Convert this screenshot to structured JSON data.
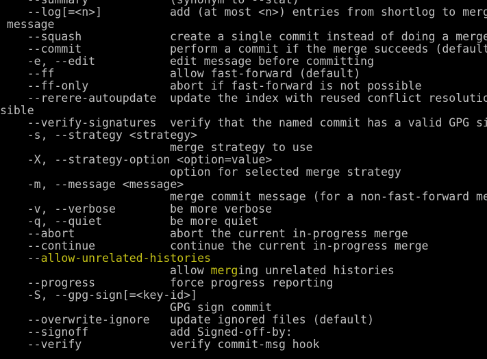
{
  "colors": {
    "background": "#000000",
    "text": "#c0c0c0",
    "highlight": "#c7c418"
  },
  "lines": [
    {
      "opt": "    --summary",
      "desc": "(synonym to --stat)"
    },
    {
      "opt": "    --log[=<n>]",
      "desc": "add (at most <n>) entries from shortlog to merge commit"
    },
    {
      "opt": " message",
      "desc": ""
    },
    {
      "opt": "    --squash",
      "desc": "create a single commit instead of doing a merge"
    },
    {
      "opt": "    --commit",
      "desc": "perform a commit if the merge succeeds (default)"
    },
    {
      "opt": "    -e, --edit",
      "desc": "edit message before committing"
    },
    {
      "opt": "    --ff",
      "desc": "allow fast-forward (default)"
    },
    {
      "opt": "    --ff-only",
      "desc": "abort if fast-forward is not possible"
    },
    {
      "opt": "    --rerere-autoupdate",
      "desc": "update the index with reused conflict resolution if pos"
    },
    {
      "opt": "sible",
      "desc": ""
    },
    {
      "opt": "    --verify-signatures",
      "desc": "verify that the named commit has a valid GPG signature"
    },
    {
      "opt": "    -s, --strategy <strategy>",
      "desc": ""
    },
    {
      "opt": "",
      "desc": "merge strategy to use"
    },
    {
      "opt": "    -X, --strategy-option <option=value>",
      "desc": ""
    },
    {
      "opt": "",
      "desc": "option for selected merge strategy"
    },
    {
      "opt": "    -m, --message <message>",
      "desc": ""
    },
    {
      "opt": "",
      "desc": "merge commit message (for a non-fast-forward merge)"
    },
    {
      "opt": "    -v, --verbose",
      "desc": "be more verbose"
    },
    {
      "opt": "    -q, --quiet",
      "desc": "be more quiet"
    },
    {
      "opt": "    --abort",
      "desc": "abort the current in-progress merge"
    },
    {
      "opt": "    --continue",
      "desc": "continue the current in-progress merge"
    },
    {
      "opt": "    --allow-unrelated-histories",
      "desc": "",
      "highlight": "allow-unrelated-histories"
    },
    {
      "opt": "",
      "desc": "allow merging unrelated histories",
      "highlight": "merg"
    },
    {
      "opt": "    --progress",
      "desc": "force progress reporting"
    },
    {
      "opt": "    -S, --gpg-sign[=<key-id>]",
      "desc": ""
    },
    {
      "opt": "",
      "desc": "GPG sign commit"
    },
    {
      "opt": "    --overwrite-ignore",
      "desc": "update ignored files (default)"
    },
    {
      "opt": "    --signoff",
      "desc": "add Signed-off-by:"
    },
    {
      "opt": "    --verify",
      "desc": "verify commit-msg hook"
    }
  ]
}
